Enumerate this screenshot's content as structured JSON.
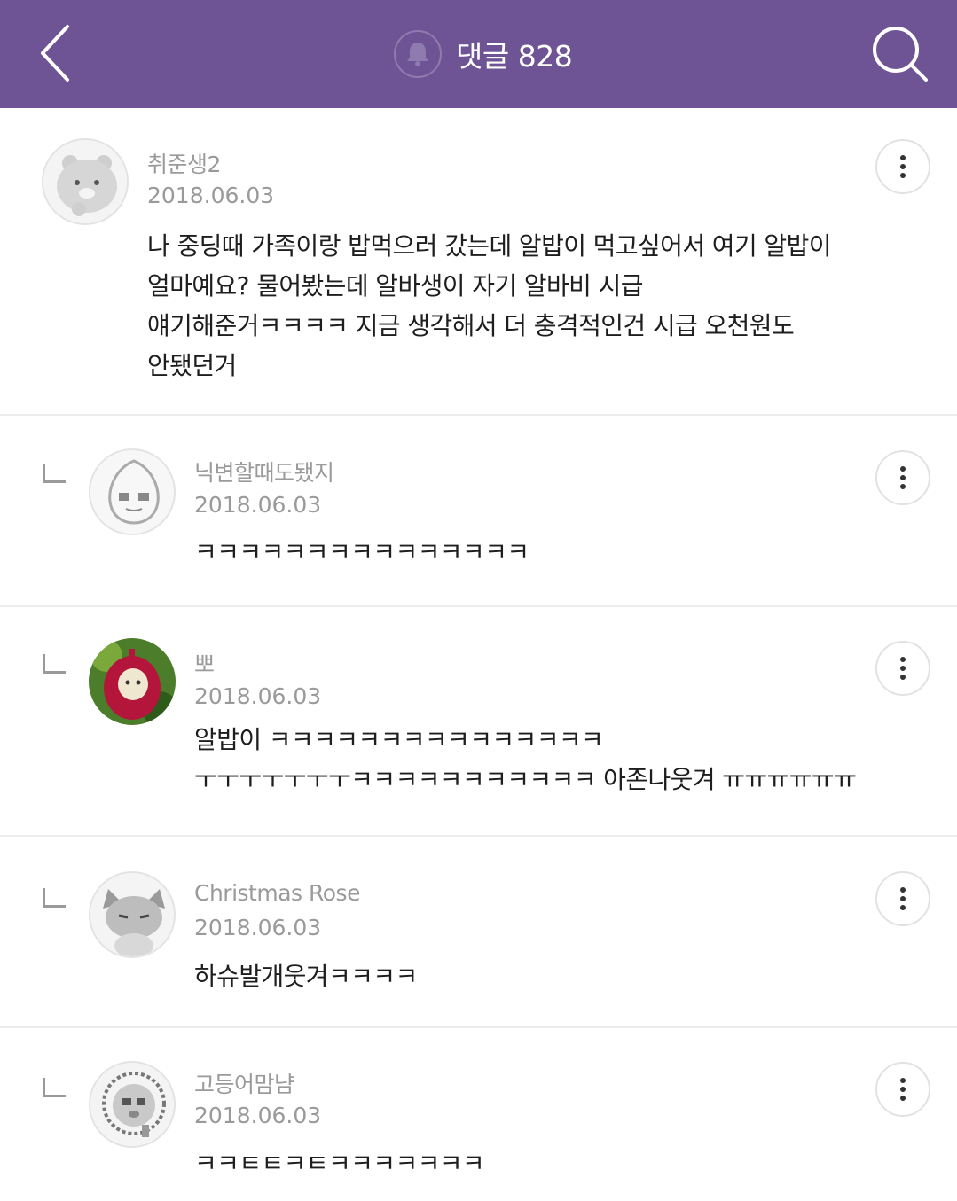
{
  "header": {
    "title": "댓글 828",
    "back_icon": "chevron-left-icon",
    "bell_icon": "bell-icon",
    "search_icon": "search-icon",
    "bg_color": "#6e5494"
  },
  "comments": [
    {
      "nickname": "취준생2",
      "date": "2018.06.03",
      "text": "나 중딩때 가족이랑 밥먹으러 갔는데 알밥이 먹고싶어서 여기 알밥이\n얼마예요? 물어봤는데 알바생이 자기 알바비 시급\n얘기해준거ㅋㅋㅋㅋ 지금 생각해서 더 충격적인건 시급 오천원도\n안됐던거",
      "is_reply": false
    },
    {
      "nickname": "닉변할때도됐지",
      "date": "2018.06.03",
      "text": "ㅋㅋㅋㅋㅋㅋㅋㅋㅋㅋㅋㅋㅋㅋㅋ",
      "is_reply": true
    },
    {
      "nickname": "뽀",
      "date": "2018.06.03",
      "text": "알밥이 ㅋㅋㅋㅋㅋㅋㅋㅋㅋㅋㅋㅋㅋㅋㅋ\nㅜㅜㅜㅜㅜㅜㅜㅋㅋㅋㅋㅋㅋㅋㅋㅋㅋㅋ 아존나웃겨 ㅠㅠㅠㅠㅠㅠ",
      "is_reply": true
    },
    {
      "nickname": "Christmas Rose",
      "date": "2018.06.03",
      "text": "하슈발개웃겨ㅋㅋㅋㅋ",
      "is_reply": true
    },
    {
      "nickname": "고등어맘냠",
      "date": "2018.06.03",
      "text": "ㅋㅋㅌㅌㅋㅌㅋㅋㅋㅋㅋㅋㅋ",
      "is_reply": true
    }
  ],
  "more_icon": "more-vertical-icon"
}
